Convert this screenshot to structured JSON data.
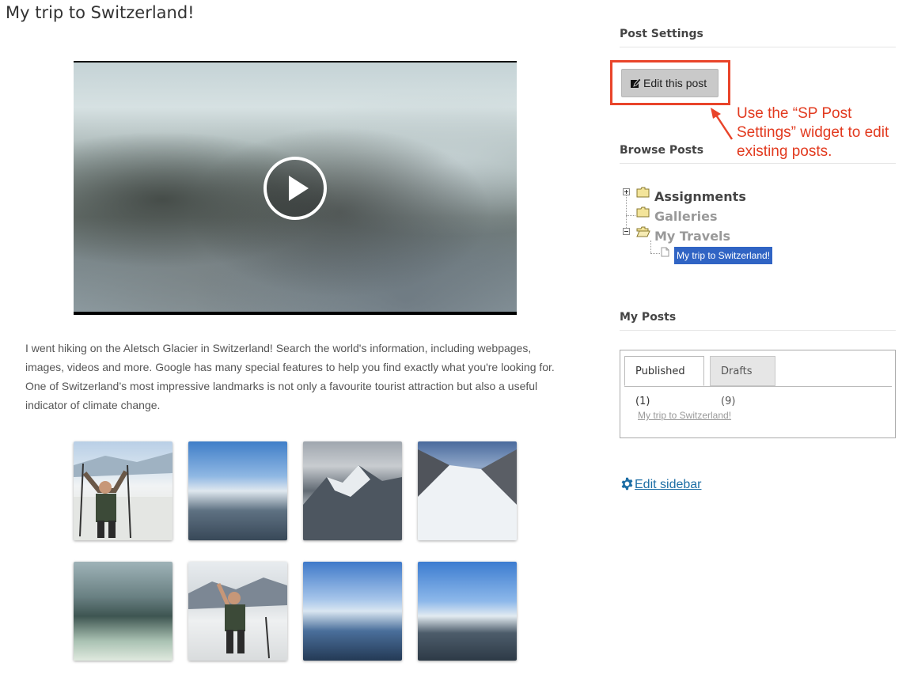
{
  "post": {
    "title": "My trip to Switzerland!",
    "body": "I went hiking on the Aletsch Glacier in Switzerland! Search the world's information, including webpages, images, videos and more. Google has many special features to help you find exactly what you're looking for. One of Switzerland’s most impressive landmarks is not only a favourite tourist attraction but also a useful indicator of climate change.",
    "video_icon": "play-icon",
    "gallery_count": 8
  },
  "sidebar": {
    "post_settings": {
      "title": "Post Settings",
      "edit_button": "Edit this post",
      "edit_icon": "pencil-icon"
    },
    "annotation": "Use the “SP Post Settings” widget to edit existing posts.",
    "browse_posts": {
      "title": "Browse Posts",
      "tree": [
        {
          "label": "Assignments",
          "icon": "folder-icon",
          "toggle": "expand"
        },
        {
          "label": "Galleries",
          "icon": "folder-icon"
        },
        {
          "label": "My Travels",
          "icon": "folder-open-icon",
          "toggle": "collapse"
        },
        {
          "label": "My trip to Switzerland!",
          "icon": "document-icon",
          "selected": true
        }
      ]
    },
    "my_posts": {
      "title": "My Posts",
      "tabs": [
        {
          "label": "Published (1)",
          "active": true
        },
        {
          "label": "Drafts (9)",
          "active": false
        }
      ],
      "published_link": "My trip to Switzerland!"
    },
    "edit_sidebar": "Edit sidebar",
    "edit_sidebar_icon": "gear-icon"
  },
  "colors": {
    "annotation": "#e23a1f",
    "highlight_border": "#e9442a",
    "tree_selected": "#3064c4",
    "link": "#1d6ea5"
  }
}
